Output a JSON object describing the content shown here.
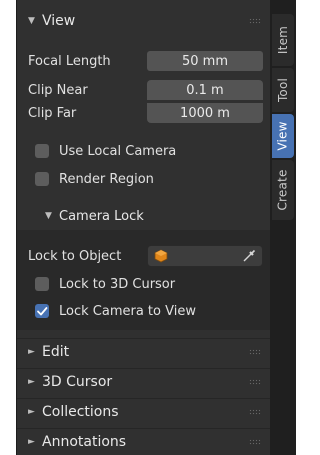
{
  "tabs": [
    {
      "label": "Item",
      "active": false
    },
    {
      "label": "Tool",
      "active": false
    },
    {
      "label": "View",
      "active": true
    },
    {
      "label": "Create",
      "active": false
    }
  ],
  "view_panel": {
    "title": "View",
    "focal_length_label": "Focal Length",
    "focal_length_value": "50 mm",
    "clip_near_label": "Clip Near",
    "clip_near_value": "0.1 m",
    "clip_far_label": "Clip Far",
    "clip_far_value": "1000 m",
    "use_local_camera_label": "Use Local Camera",
    "use_local_camera_checked": false,
    "render_region_label": "Render Region",
    "render_region_checked": false
  },
  "camera_lock": {
    "title": "Camera Lock",
    "lock_to_object_label": "Lock to Object",
    "lock_to_3d_cursor_label": "Lock to 3D Cursor",
    "lock_to_3d_cursor_checked": false,
    "lock_camera_to_view_label": "Lock Camera to View",
    "lock_camera_to_view_checked": true
  },
  "collapsed_panels": [
    {
      "title": "Edit"
    },
    {
      "title": "3D Cursor"
    },
    {
      "title": "Collections"
    },
    {
      "title": "Annotations"
    }
  ],
  "colors": {
    "accent": "#4772b3",
    "panel_bg": "#303030",
    "field_bg": "#545454",
    "object_icon": "#e0861a"
  }
}
